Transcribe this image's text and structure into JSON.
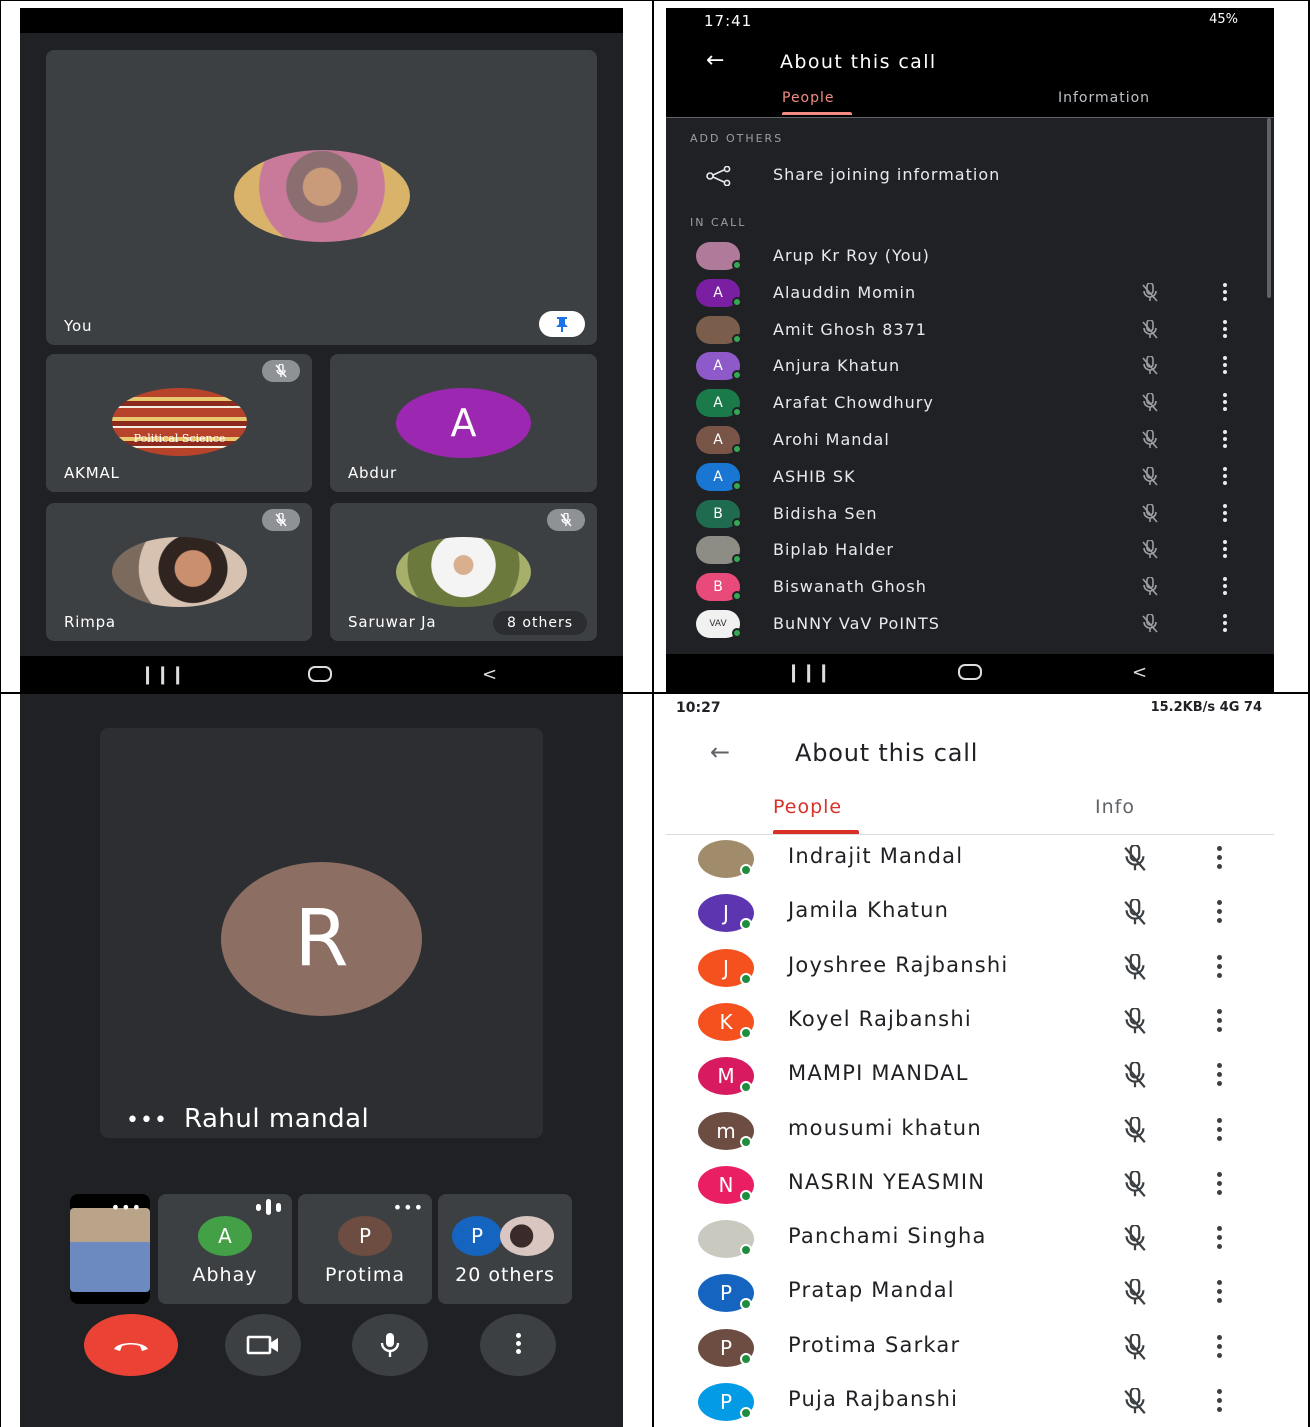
{
  "panel1": {
    "main_tile": {
      "name": "You"
    },
    "tiles": [
      {
        "name": "AKMAL",
        "picture_text": "Political Science"
      },
      {
        "name": "Abdur",
        "initial": "A",
        "color": "#9c27b0"
      },
      {
        "name": "Rimpa"
      },
      {
        "name": "Saruwar Ja",
        "others_chip": "8 others"
      }
    ]
  },
  "panel2": {
    "status_time": "17:41",
    "status_right": "45%",
    "title": "About this call",
    "tabs": [
      "People",
      "Information"
    ],
    "add_others_label": "ADD OTHERS",
    "share_label": "Share joining information",
    "in_call_label": "IN CALL",
    "participants": [
      {
        "name": "Arup Kr Roy (You)",
        "initial": "",
        "color": "#b07a9a"
      },
      {
        "name": "Alauddin Momin",
        "initial": "A",
        "color": "#7b1fa2"
      },
      {
        "name": "Amit Ghosh 8371",
        "initial": "",
        "color": "#7a5d4a"
      },
      {
        "name": "Anjura Khatun",
        "initial": "A",
        "color": "#8e59c9"
      },
      {
        "name": "Arafat Chowdhury",
        "initial": "A",
        "color": "#1b7a4a"
      },
      {
        "name": "Arohi Mandal",
        "initial": "A",
        "color": "#795548"
      },
      {
        "name": "ASHIB SK",
        "initial": "A",
        "color": "#1976d2"
      },
      {
        "name": "Bidisha Sen",
        "initial": "B",
        "color": "#1e6b4f"
      },
      {
        "name": "Biplab Halder",
        "initial": "",
        "color": "#8d8d85"
      },
      {
        "name": "Biswanath Ghosh",
        "initial": "B",
        "color": "#e84a7a"
      },
      {
        "name": "BuNNY VaV PoINTS",
        "initial": "VAV",
        "color": "#f1f1f1"
      }
    ]
  },
  "panel3": {
    "main_name": "Rahul mandal",
    "main_initial": "R",
    "main_color": "#8d6e63",
    "mini_tiles": [
      {
        "name": "Abhay",
        "initial": "A",
        "color": "#43a047"
      },
      {
        "name": "Protima",
        "initial": "P",
        "color": "#6d4c41"
      },
      {
        "name": "20 others",
        "initial": "P",
        "color": "#1565c0"
      }
    ],
    "end_call_color": "#ea4335"
  },
  "panel4": {
    "status_time": "10:27",
    "status_right": "15.2KB/s  4G  74",
    "title": "About this call",
    "tabs": [
      "People",
      "Info"
    ],
    "participants": [
      {
        "name": "Indrajit Mandal",
        "initial": "",
        "color": "#a08c6a"
      },
      {
        "name": "Jamila Khatun",
        "initial": "J",
        "color": "#5e35b1"
      },
      {
        "name": "Joyshree Rajbanshi",
        "initial": "J",
        "color": "#f4511e"
      },
      {
        "name": "Koyel Rajbanshi",
        "initial": "K",
        "color": "#f4511e"
      },
      {
        "name": "MAMPI MANDAL",
        "initial": "M",
        "color": "#d81b60"
      },
      {
        "name": "mousumi khatun",
        "initial": "m",
        "color": "#6d4c41"
      },
      {
        "name": "NASRIN YEASMIN",
        "initial": "N",
        "color": "#e91e63"
      },
      {
        "name": "Panchami Singha",
        "initial": "",
        "color": "#c9c9c0"
      },
      {
        "name": "Pratap Mandal",
        "initial": "P",
        "color": "#1565c0"
      },
      {
        "name": "Protima Sarkar",
        "initial": "P",
        "color": "#6d4c41"
      },
      {
        "name": "Puja Rajbanshi",
        "initial": "P",
        "color": "#039be5"
      }
    ]
  }
}
